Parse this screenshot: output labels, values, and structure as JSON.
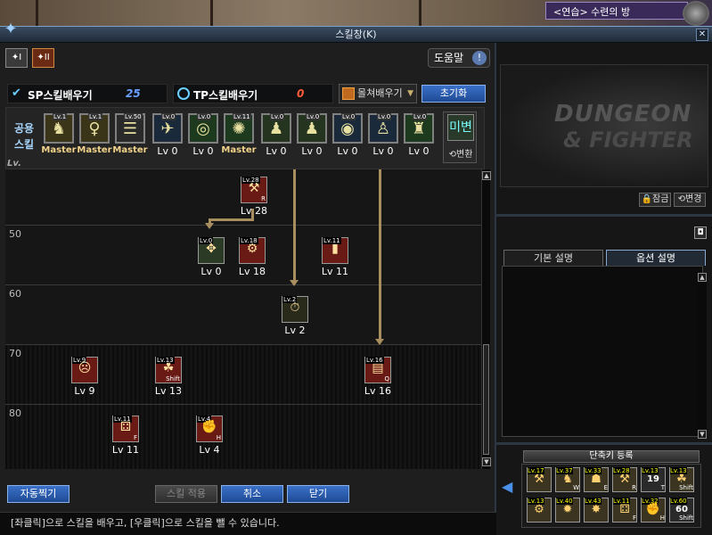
{
  "location": {
    "label": "<연습> 수련의 방"
  },
  "window": {
    "title": "스킬창(K)",
    "logo_glyph": "✦",
    "close_glyph": "✕"
  },
  "tabs": [
    {
      "label": "✦I"
    },
    {
      "label": "✦II"
    }
  ],
  "help": {
    "label": "도움말",
    "glyph": "!"
  },
  "sp": {
    "label": "SP스킬배우기",
    "value": "25",
    "value_color": "#6aa0ff"
  },
  "tp": {
    "label": "TP스킬배우기",
    "value": "0",
    "value_color": "#ff5a3a"
  },
  "dropdown": {
    "label": "몰쳐배우기",
    "caret": "▼"
  },
  "reset": {
    "label": "초기화"
  },
  "common": {
    "label": "공용 스킬",
    "skills": [
      {
        "tag": "Lv.1",
        "level": "Master",
        "glyph": "♞",
        "master": true,
        "bg": "#3a3418"
      },
      {
        "tag": "Lv.1",
        "level": "Master",
        "glyph": "♀",
        "master": true,
        "bg": "#3a3418"
      },
      {
        "tag": "Lv.50",
        "level": "Master",
        "glyph": "☰",
        "master": true,
        "bg": "#2a2a2a"
      },
      {
        "tag": "Lv.0",
        "level": "Lv 0",
        "glyph": "✈",
        "master": false,
        "bg": "#1a2a3a"
      },
      {
        "tag": "Lv.0",
        "level": "Lv 0",
        "glyph": "◎",
        "master": false,
        "bg": "#1e3a1e"
      },
      {
        "tag": "Lv.11",
        "level": "Master",
        "glyph": "✺",
        "master": true,
        "bg": "#1e3a1e"
      },
      {
        "tag": "Lv.0",
        "level": "Lv 0",
        "glyph": "♟",
        "master": false,
        "bg": "#24341e"
      },
      {
        "tag": "Lv.0",
        "level": "Lv 0",
        "glyph": "♟",
        "master": false,
        "bg": "#24341e"
      },
      {
        "tag": "Lv.0",
        "level": "Lv 0",
        "glyph": "◉",
        "master": false,
        "bg": "#1a2a3a"
      },
      {
        "tag": "Lv.0",
        "level": "Lv 0",
        "glyph": "♙",
        "master": false,
        "bg": "#1a2a3a"
      },
      {
        "tag": "Lv.0",
        "level": "Lv 0",
        "glyph": "♜",
        "master": false,
        "bg": "#1e3a1e"
      }
    ],
    "convert": {
      "label": "⟲변환",
      "icon_label": "미변"
    }
  },
  "tree": {
    "lv_header": "Lv.",
    "levels": [
      "50",
      "60",
      "70",
      "80"
    ],
    "skills": [
      {
        "level": "Lv 28",
        "tag": "Lv.28",
        "glyph": "⚒",
        "key": "R",
        "color": "red"
      },
      {
        "level": "Lv 0",
        "tag": "Lv.0",
        "glyph": "✥",
        "key": "",
        "color": "green"
      },
      {
        "level": "Lv 18",
        "tag": "Lv.18",
        "glyph": "⚙",
        "key": "",
        "color": "red"
      },
      {
        "level": "Lv 11",
        "tag": "Lv.11",
        "glyph": "▮",
        "key": "",
        "color": "red"
      },
      {
        "level": "Lv 2",
        "tag": "Lv.2",
        "glyph": "⏱",
        "key": "",
        "color": "dark"
      },
      {
        "level": "Lv 9",
        "tag": "Lv.9",
        "glyph": "☹",
        "key": "",
        "color": "red"
      },
      {
        "level": "Lv 13",
        "tag": "Lv.13",
        "glyph": "☘",
        "key": "Shift",
        "color": "red"
      },
      {
        "level": "Lv 16",
        "tag": "Lv.16",
        "glyph": "▤",
        "key": "Q",
        "color": "red"
      },
      {
        "level": "Lv 11",
        "tag": "Lv.11",
        "glyph": "⚃",
        "key": "F",
        "color": "red"
      },
      {
        "level": "Lv 4",
        "tag": "Lv.4",
        "glyph": "✊",
        "key": "H",
        "color": "red"
      }
    ]
  },
  "scroll": {
    "up": "▲",
    "down": "▼"
  },
  "buttons": {
    "auto": "자동찍기",
    "apply": "스킬 적용",
    "cancel": "취소",
    "close": "닫기"
  },
  "hint": "[좌클릭]으로 스킬을 배우고, [우클릭]으로 스킬을 뺄 수 있습니다.",
  "preview": {
    "logo_line1": "DUNGEON",
    "logo_line2": "& FIGHTER",
    "lock": "🔒잠금",
    "change": "⟲변경",
    "cam": "◘"
  },
  "desc_tabs": {
    "basic": "기본 설명",
    "option": "옵션 설명"
  },
  "quickslot": {
    "title": "단축키 등록",
    "arrow": "◀",
    "slots": [
      {
        "tag": "Lv.17",
        "glyph": "⚒",
        "key": "",
        "num": ""
      },
      {
        "tag": "Lv.37",
        "glyph": "♞",
        "key": "W",
        "num": ""
      },
      {
        "tag": "Lv.33",
        "glyph": "☗",
        "key": "E",
        "num": ""
      },
      {
        "tag": "Lv.28",
        "glyph": "⚒",
        "key": "R",
        "num": ""
      },
      {
        "tag": "Lv.13",
        "glyph": "",
        "key": "T",
        "num": "19"
      },
      {
        "tag": "Lv.13",
        "glyph": "☘",
        "key": "Shift",
        "num": ""
      },
      {
        "tag": "Lv.13",
        "glyph": "⚙",
        "key": "",
        "num": ""
      },
      {
        "tag": "Lv.40",
        "glyph": "✹",
        "key": "",
        "num": ""
      },
      {
        "tag": "Lv.43",
        "glyph": "✸",
        "key": "",
        "num": ""
      },
      {
        "tag": "Lv.11",
        "glyph": "⚃",
        "key": "F",
        "num": ""
      },
      {
        "tag": "Lv.32",
        "glyph": "✊",
        "key": "H",
        "num": ""
      },
      {
        "tag": "Lv.60",
        "glyph": "",
        "key": "Shift",
        "num": "60"
      }
    ]
  }
}
